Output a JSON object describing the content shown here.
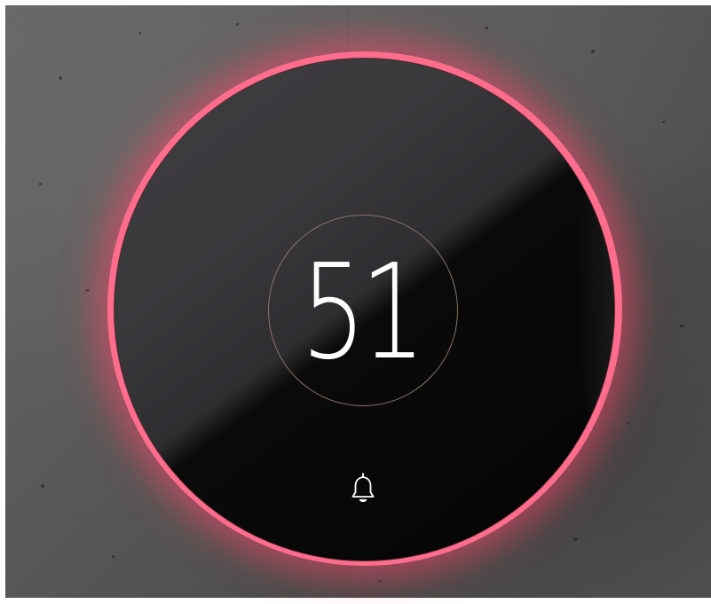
{
  "display": {
    "value": "51"
  },
  "controls": {
    "notification_icon": "bell-icon"
  },
  "colors": {
    "glow_ring": "#ff4d74",
    "device_face": "#060606",
    "dial_outline": "#8c7468",
    "reading_text": "#ffffff",
    "wall": "#5a5957"
  }
}
